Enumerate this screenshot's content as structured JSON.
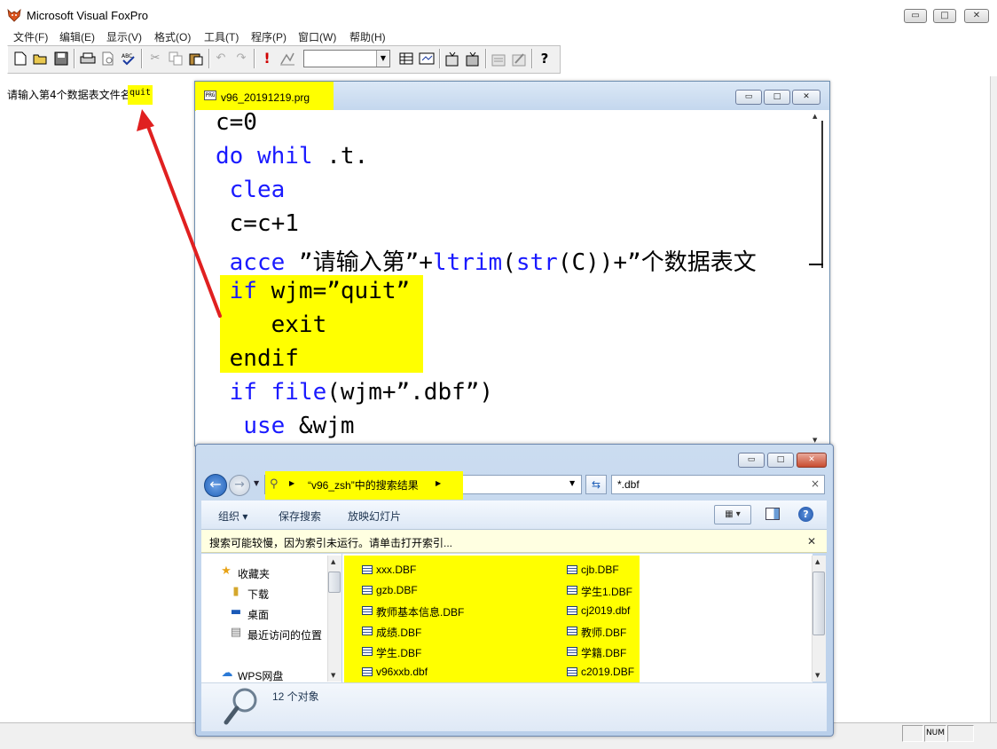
{
  "app": {
    "title": "Microsoft Visual FoxPro",
    "window_buttons": {
      "minimize": "▭",
      "maximize": "□",
      "close": "✕"
    }
  },
  "menu": [
    "文件(F)",
    "编辑(E)",
    "显示(V)",
    "格式(O)",
    "工具(T)",
    "程序(P)",
    "窗口(W)",
    "帮助(H)"
  ],
  "toolbar": {
    "icons": [
      "new-file-icon",
      "open-icon",
      "save-icon",
      "print-icon",
      "print-preview-icon",
      "spell-check-icon",
      "cut-icon",
      "copy-icon",
      "paste-icon",
      "undo-icon",
      "redo-icon",
      "run-icon",
      "modify-form-icon",
      "database-icon",
      "command-window-icon",
      "form-designer-icon",
      "report-designer-icon",
      "build-icon",
      "wizard-icon",
      "help-icon"
    ],
    "combo_value": ""
  },
  "output": {
    "prompt": "请输入第4个数据表文件名",
    "typed": "quit"
  },
  "editor": {
    "title": "v96_20191219.prg",
    "icon_text": "PRG",
    "code_lines": [
      {
        "plain_a": "c=0",
        "kw": "",
        "plain_b": ""
      },
      {
        "plain_a": "",
        "kw": "do whil",
        "plain_b": " .t."
      },
      {
        "plain_a": " ",
        "kw": "clea",
        "plain_b": ""
      },
      {
        "plain_a": " c=c+1",
        "kw": "",
        "plain_b": ""
      },
      {
        "plain_a": " ",
        "kw": "acce",
        "plain_b": " ”请输入第”+",
        "kw2": "ltrim",
        "plain_c": "(",
        "kw3": "str",
        "plain_d": "(C))+”个数据表文"
      },
      {
        "plain_a": " ",
        "kw": "if",
        "plain_b": " wjm=”quit”"
      },
      {
        "plain_a": "    exit",
        "kw": "",
        "plain_b": ""
      },
      {
        "plain_a": " endif",
        "kw": "",
        "plain_b": ""
      },
      {
        "plain_a": " ",
        "kw": "if file",
        "plain_b": "(wjm+”.dbf”)"
      },
      {
        "plain_a": "  ",
        "kw": "use",
        "plain_b": " &wjm"
      }
    ]
  },
  "explorer": {
    "address_text": "“v96_zsh”中的搜索结果",
    "search_value": "*.dbf",
    "commands": [
      "组织 ▾",
      "保存搜索",
      "放映幻灯片"
    ],
    "info_bar": "搜索可能较慢，因为索引未运行。请单击打开索引...",
    "nav_items": [
      {
        "label": "收藏夹",
        "icon": "star-icon"
      },
      {
        "label": "下载",
        "icon": "download-folder-icon"
      },
      {
        "label": "桌面",
        "icon": "desktop-icon"
      },
      {
        "label": "最近访问的位置",
        "icon": "recent-places-icon"
      },
      {
        "label": "WPS网盘",
        "icon": "cloud-icon"
      }
    ],
    "files_col1": [
      "xxx.DBF",
      "gzb.DBF",
      "教师基本信息.DBF",
      "成绩.DBF",
      "学生.DBF",
      "v96xxb.dbf"
    ],
    "files_col2": [
      "cjb.DBF",
      "学生1.DBF",
      "cj2019.dbf",
      "教师.DBF",
      "学籍.DBF",
      "c2019.DBF"
    ],
    "item_count": "12 个对象"
  },
  "statusbar": {
    "num": "NUM"
  },
  "colors": {
    "highlight": "#ffff00",
    "keyword": "#1a1aff",
    "arrow": "#e02020"
  }
}
